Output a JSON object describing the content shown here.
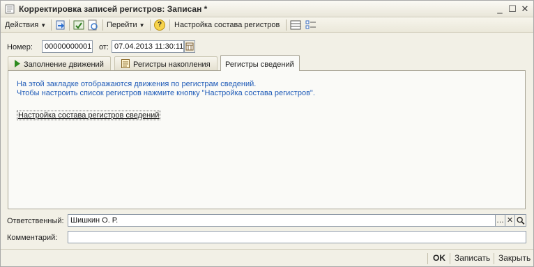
{
  "window": {
    "title": "Корректировка записей регистров: Записан *",
    "controls": {
      "minimize": "_",
      "maximize": "☐",
      "close": "✕"
    }
  },
  "toolbar": {
    "actions_label": "Действия",
    "goto_label": "Перейти",
    "help_label": "?",
    "registers_setup_label": "Настройка состава регистров"
  },
  "header": {
    "number_label": "Номер:",
    "number_value": "00000000001",
    "date_label": "от:",
    "date_value": "07.04.2013 11:30:11"
  },
  "tabs": [
    {
      "label": "Заполнение движений",
      "active": false
    },
    {
      "label": "Регистры накопления",
      "active": false
    },
    {
      "label": "Регистры сведений",
      "active": true
    }
  ],
  "panel": {
    "info_line1": "На этой закладке отображаются движения по регистрам сведений.",
    "info_line2": "Чтобы настроить список регистров нажмите кнопку \"Настройка состава регистров\".",
    "link_label": "Настройка состава регистров сведений"
  },
  "responsible": {
    "label": "Ответственный:",
    "value": "Шишкин О. Р."
  },
  "comment": {
    "label": "Комментарий:",
    "value": ""
  },
  "footer": {
    "ok_label": "OK",
    "save_label": "Записать",
    "close_label": "Закрыть"
  },
  "colors": {
    "info_text": "#1f5bb8",
    "window_bg": "#f2f0e6",
    "field_border": "#8f9ba8"
  }
}
